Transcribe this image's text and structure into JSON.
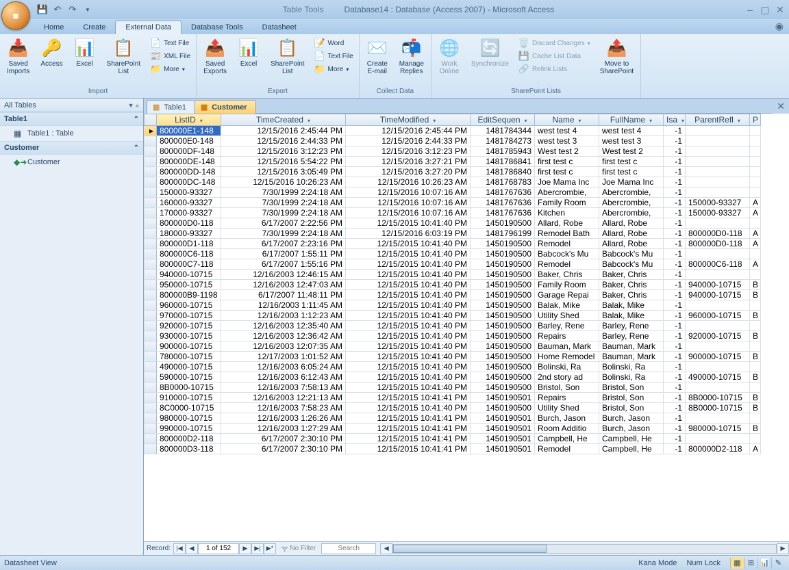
{
  "title_context": "Table Tools",
  "title_app": "Database14 : Database (Access 2007) - Microsoft Access",
  "tabs": [
    "Home",
    "Create",
    "External Data",
    "Database Tools",
    "Datasheet"
  ],
  "active_tab": "External Data",
  "ribbon": {
    "import": {
      "label": "Import",
      "saved_imports": "Saved\nImports",
      "access": "Access",
      "excel": "Excel",
      "sp_list": "SharePoint\nList",
      "text_file": "Text File",
      "xml_file": "XML File",
      "more": "More"
    },
    "export": {
      "label": "Export",
      "saved_exports": "Saved\nExports",
      "excel": "Excel",
      "sp_list": "SharePoint\nList",
      "word": "Word",
      "text_file": "Text File",
      "more": "More"
    },
    "collect": {
      "label": "Collect Data",
      "create_email": "Create\nE-mail",
      "manage_replies": "Manage\nReplies"
    },
    "sp_lists": {
      "label": "SharePoint Lists",
      "work_online": "Work\nOnline",
      "synchronize": "Synchronize",
      "discard": "Discard Changes",
      "cache": "Cache List Data",
      "relink": "Relink Lists",
      "move_to": "Move to\nSharePoint"
    }
  },
  "nav": {
    "header": "All Tables",
    "section1": "Table1",
    "item1": "Table1 : Table",
    "section2": "Customer",
    "item2": "Customer"
  },
  "doc_tabs": [
    "Table1",
    "Customer"
  ],
  "active_doc_tab": "Customer",
  "columns": [
    "ListID",
    "TimeCreated",
    "TimeModified",
    "EditSequen",
    "Name",
    "FullName",
    "Isa",
    "ParentRefl",
    "P"
  ],
  "rows": [
    [
      "800000E1-148",
      "12/15/2016 2:45:44 PM",
      "12/15/2016 2:45:44 PM",
      "1481784344",
      "west test 4",
      "west test 4",
      "-1",
      "",
      ""
    ],
    [
      "800000E0-148",
      "12/15/2016 2:44:33 PM",
      "12/15/2016 2:44:33 PM",
      "1481784273",
      "west test 3",
      "west test 3",
      "-1",
      "",
      ""
    ],
    [
      "800000DF-148",
      "12/15/2016 3:12:23 PM",
      "12/15/2016 3:12:23 PM",
      "1481785943",
      "West test 2",
      "West test 2",
      "-1",
      "",
      ""
    ],
    [
      "800000DE-148",
      "12/15/2016 5:54:22 PM",
      "12/15/2016 3:27:21 PM",
      "1481786841",
      "first test c",
      "first test c",
      "-1",
      "",
      ""
    ],
    [
      "800000DD-148",
      "12/15/2016 3:05:49 PM",
      "12/15/2016 3:27:20 PM",
      "1481786840",
      "first test c",
      "first test c",
      "-1",
      "",
      ""
    ],
    [
      "800000DC-148",
      "12/15/2016 10:26:23 AM",
      "12/15/2016 10:26:23 AM",
      "1481768783",
      "Joe Mama Inc",
      "Joe Mama Inc",
      "-1",
      "",
      ""
    ],
    [
      "150000-93327",
      "7/30/1999 2:24:18 AM",
      "12/15/2016 10:07:16 AM",
      "1481767636",
      "Abercrombie,",
      "Abercrombie,",
      "-1",
      "",
      ""
    ],
    [
      "160000-93327",
      "7/30/1999 2:24:18 AM",
      "12/15/2016 10:07:16 AM",
      "1481767636",
      "Family Room",
      "Abercrombie,",
      "-1",
      "150000-93327",
      "A"
    ],
    [
      "170000-93327",
      "7/30/1999 2:24:18 AM",
      "12/15/2016 10:07:16 AM",
      "1481767636",
      "Kitchen",
      "Abercrombie,",
      "-1",
      "150000-93327",
      "A"
    ],
    [
      "800000D0-118",
      "6/17/2007 2:22:56 PM",
      "12/15/2015 10:41:40 PM",
      "1450190500",
      "Allard, Robe",
      "Allard, Robe",
      "-1",
      "",
      ""
    ],
    [
      "180000-93327",
      "7/30/1999 2:24:18 AM",
      "12/15/2016 6:03:19 PM",
      "1481796199",
      "Remodel Bath",
      "Allard, Robe",
      "-1",
      "800000D0-118",
      "A"
    ],
    [
      "800000D1-118",
      "6/17/2007 2:23:16 PM",
      "12/15/2015 10:41:40 PM",
      "1450190500",
      "Remodel",
      "Allard, Robe",
      "-1",
      "800000D0-118",
      "A"
    ],
    [
      "800000C6-118",
      "6/17/2007 1:55:11 PM",
      "12/15/2015 10:41:40 PM",
      "1450190500",
      "Babcock's Mu",
      "Babcock's Mu",
      "-1",
      "",
      ""
    ],
    [
      "800000C7-118",
      "6/17/2007 1:55:16 PM",
      "12/15/2015 10:41:40 PM",
      "1450190500",
      "Remodel",
      "Babcock's Mu",
      "-1",
      "800000C6-118",
      "A"
    ],
    [
      "940000-10715",
      "12/16/2003 12:46:15 AM",
      "12/15/2015 10:41:40 PM",
      "1450190500",
      "Baker, Chris",
      "Baker, Chris",
      "-1",
      "",
      ""
    ],
    [
      "950000-10715",
      "12/16/2003 12:47:03 AM",
      "12/15/2015 10:41:40 PM",
      "1450190500",
      "Family Room",
      "Baker, Chris",
      "-1",
      "940000-10715",
      "B"
    ],
    [
      "800000B9-1198",
      "6/17/2007 11:48:11 PM",
      "12/15/2015 10:41:40 PM",
      "1450190500",
      "Garage Repai",
      "Baker, Chris",
      "-1",
      "940000-10715",
      "B"
    ],
    [
      "960000-10715",
      "12/16/2003 1:11:45 AM",
      "12/15/2015 10:41:40 PM",
      "1450190500",
      "Balak, Mike",
      "Balak, Mike",
      "-1",
      "",
      ""
    ],
    [
      "970000-10715",
      "12/16/2003 1:12:23 AM",
      "12/15/2015 10:41:40 PM",
      "1450190500",
      "Utility Shed",
      "Balak, Mike",
      "-1",
      "960000-10715",
      "B"
    ],
    [
      "920000-10715",
      "12/16/2003 12:35:40 AM",
      "12/15/2015 10:41:40 PM",
      "1450190500",
      "Barley, Rene",
      "Barley, Rene",
      "-1",
      "",
      ""
    ],
    [
      "930000-10715",
      "12/16/2003 12:36:42 AM",
      "12/15/2015 10:41:40 PM",
      "1450190500",
      "Repairs",
      "Barley, Rene",
      "-1",
      "920000-10715",
      "B"
    ],
    [
      "900000-10715",
      "12/16/2003 12:07:35 AM",
      "12/15/2015 10:41:40 PM",
      "1450190500",
      "Bauman, Mark",
      "Bauman, Mark",
      "-1",
      "",
      ""
    ],
    [
      "780000-10715",
      "12/17/2003 1:01:52 AM",
      "12/15/2015 10:41:40 PM",
      "1450190500",
      "Home Remodel",
      "Bauman, Mark",
      "-1",
      "900000-10715",
      "B"
    ],
    [
      "490000-10715",
      "12/16/2003 6:05:24 AM",
      "12/15/2015 10:41:40 PM",
      "1450190500",
      "Bolinski, Ra",
      "Bolinski, Ra",
      "-1",
      "",
      ""
    ],
    [
      "590000-10715",
      "12/16/2003 6:12:43 AM",
      "12/15/2015 10:41:40 PM",
      "1450190500",
      "2nd story ad",
      "Bolinski, Ra",
      "-1",
      "490000-10715",
      "B"
    ],
    [
      "8B0000-10715",
      "12/16/2003 7:58:13 AM",
      "12/15/2015 10:41:40 PM",
      "1450190500",
      "Bristol, Son",
      "Bristol, Son",
      "-1",
      "",
      ""
    ],
    [
      "910000-10715",
      "12/16/2003 12:21:13 AM",
      "12/15/2015 10:41:41 PM",
      "1450190501",
      "Repairs",
      "Bristol, Son",
      "-1",
      "8B0000-10715",
      "B"
    ],
    [
      "8C0000-10715",
      "12/16/2003 7:58:23 AM",
      "12/15/2015 10:41:40 PM",
      "1450190500",
      "Utility Shed",
      "Bristol, Son",
      "-1",
      "8B0000-10715",
      "B"
    ],
    [
      "980000-10715",
      "12/16/2003 1:26:26 AM",
      "12/15/2015 10:41:41 PM",
      "1450190501",
      "Burch, Jason",
      "Burch, Jason",
      "-1",
      "",
      ""
    ],
    [
      "990000-10715",
      "12/16/2003 1:27:29 AM",
      "12/15/2015 10:41:41 PM",
      "1450190501",
      "Room Additio",
      "Burch, Jason",
      "-1",
      "980000-10715",
      "B"
    ],
    [
      "800000D2-118",
      "6/17/2007 2:30:10 PM",
      "12/15/2015 10:41:41 PM",
      "1450190501",
      "Campbell, He",
      "Campbell, He",
      "-1",
      "",
      ""
    ],
    [
      "800000D3-118",
      "6/17/2007 2:30:10 PM",
      "12/15/2015 10:41:41 PM",
      "1450190501",
      "Remodel",
      "Campbell, He",
      "-1",
      "800000D2-118",
      "A"
    ]
  ],
  "record_nav": {
    "label": "Record:",
    "current": "1 of 152",
    "no_filter": "No Filter",
    "search_ph": "Search"
  },
  "status": {
    "view": "Datasheet View",
    "kana": "Kana Mode",
    "numlock": "Num Lock"
  }
}
